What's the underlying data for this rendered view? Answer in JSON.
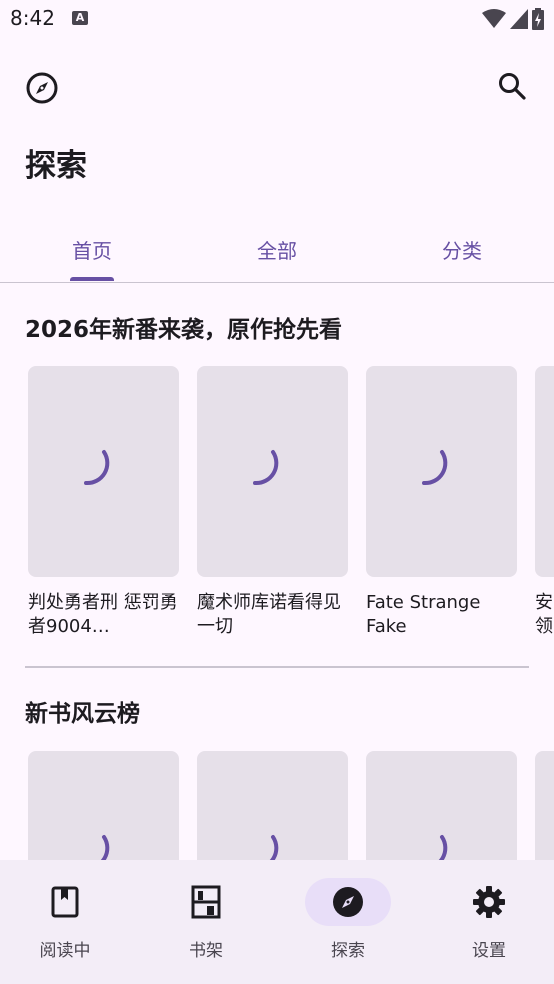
{
  "status_bar": {
    "time": "8:42",
    "notif_badge": "A"
  },
  "page": {
    "title": "探索"
  },
  "tabs": [
    {
      "label": "首页",
      "selected": true
    },
    {
      "label": "全部",
      "selected": false
    },
    {
      "label": "分类",
      "selected": false
    }
  ],
  "sections": [
    {
      "title": "2026年新番来袭，原作抢先看",
      "books": [
        {
          "title": "判处勇者刑 惩罚勇者9004…"
        },
        {
          "title": "魔术师库诺看得见一切"
        },
        {
          "title": "Fate Strange Fake"
        },
        {
          "title": "安\n领"
        }
      ]
    },
    {
      "title": "新书风云榜",
      "books": [
        {
          "title": ""
        },
        {
          "title": ""
        },
        {
          "title": ""
        },
        {
          "title": ""
        }
      ]
    }
  ],
  "bottom_nav": [
    {
      "label": "阅读中",
      "icon": "book-icon",
      "active": false
    },
    {
      "label": "书架",
      "icon": "bookshelf-icon",
      "active": false
    },
    {
      "label": "探索",
      "icon": "compass-icon",
      "active": true
    },
    {
      "label": "设置",
      "icon": "gear-icon",
      "active": false
    }
  ],
  "colors": {
    "primary": "#6750A4",
    "background": "#FEF7FF",
    "surface_container": "#F3EDF7",
    "active_indicator": "#E8DEF8",
    "placeholder": "#E6E0E9"
  }
}
